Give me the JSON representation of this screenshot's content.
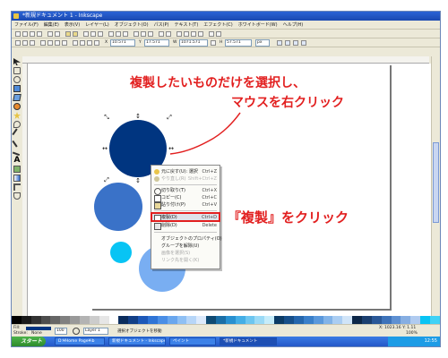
{
  "window": {
    "title": "*新規ドキュメント 1 - Inkscape"
  },
  "menu": [
    "ファイル(F)",
    "編集(E)",
    "表示(V)",
    "レイヤー(L)",
    "オブジェクト(O)",
    "パス(P)",
    "テキスト(T)",
    "エフェクト(C)",
    "ホワイトボード(W)",
    "ヘルプ(H)"
  ],
  "tool_controls": {
    "x": "10.571",
    "y": "17.571",
    "w": "1071.571",
    "h": "57.571",
    "unit": "px"
  },
  "annotations": {
    "instruction_line1": "複製したいものだけを選択し、",
    "instruction_line2": "マウスを右クリック",
    "instruction_duplicate": "『複製』をクリック"
  },
  "context_menu": [
    {
      "label": "元に戻す(U): 選択",
      "shortcut": "Ctrl+Z",
      "icon": "undo-icon",
      "disabled": false
    },
    {
      "label": "やり直し(R)",
      "shortcut": "Shift+Ctrl+Z",
      "icon": "redo-icon",
      "disabled": true
    },
    {
      "label": "切り取り(T)",
      "shortcut": "Ctrl+X",
      "icon": "cut-icon",
      "disabled": false
    },
    {
      "label": "コピー(C)",
      "shortcut": "Ctrl+C",
      "icon": "copy-icon",
      "disabled": false
    },
    {
      "label": "貼り付け(P)",
      "shortcut": "Ctrl+V",
      "icon": "paste-icon",
      "disabled": false
    },
    {
      "label": "複製(D)",
      "shortcut": "Ctrl+D",
      "icon": "duplicate-icon",
      "disabled": false
    },
    {
      "label": "削除(D)",
      "shortcut": "Delete",
      "icon": "delete-icon",
      "disabled": false
    },
    {
      "label": "オブジェクトのプロパティ(O)",
      "shortcut": "",
      "icon": "",
      "disabled": false
    },
    {
      "label": "グループを解除(U)",
      "shortcut": "",
      "icon": "",
      "disabled": false
    },
    {
      "label": "画像を選択(S)",
      "shortcut": "",
      "icon": "",
      "disabled": true
    },
    {
      "label": "リンク先を開く(K)",
      "shortcut": "",
      "icon": "",
      "disabled": true
    }
  ],
  "status": {
    "fill_label": "Fill:",
    "stroke_label": "Stroke:",
    "stroke_value": "None",
    "opacity": "100",
    "layer": "Layer 1",
    "message": "選択オブジェクトを移動",
    "coords": "X: 1023.16  Y: 1.11",
    "zoom": "100%"
  },
  "taskbar": {
    "start": "スタート",
    "tasks": [
      "D:¥Home Page¥ib",
      "新規ドキュメント - Inkscape",
      "ペイント",
      "*新規ドキュメント"
    ],
    "clock": "12:55"
  },
  "colors": {
    "callout_red": "#e21f1f",
    "circle_navy": "#003580",
    "circle_blue": "#3a72c8",
    "circle_cyan": "#08c4f4",
    "circle_light": "#79aef2"
  }
}
